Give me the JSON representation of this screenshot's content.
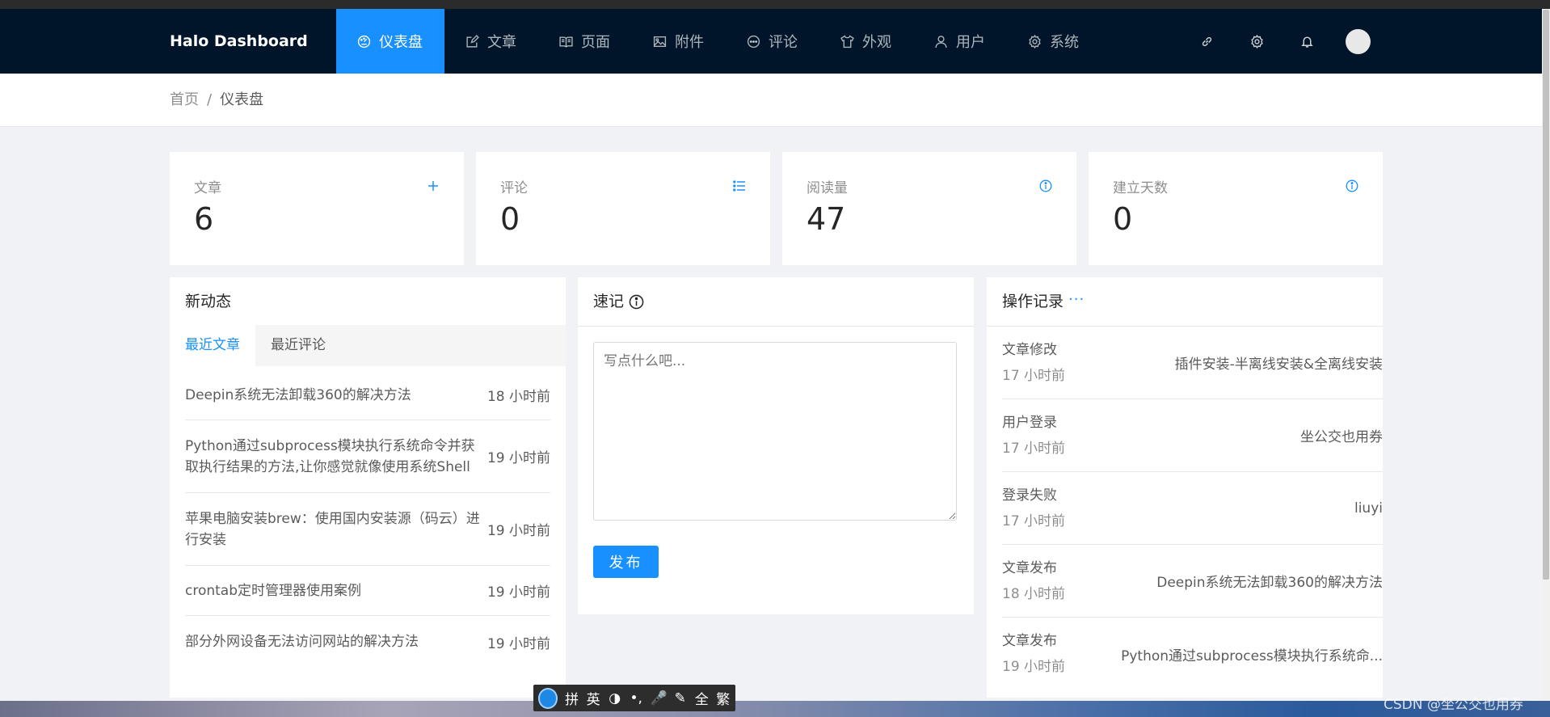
{
  "header": {
    "logo": "Halo  Dashboard",
    "nav": [
      {
        "label": "仪表盘",
        "icon": "dashboard-icon",
        "active": true
      },
      {
        "label": "文章",
        "icon": "edit-icon",
        "active": false
      },
      {
        "label": "页面",
        "icon": "book-icon",
        "active": false
      },
      {
        "label": "附件",
        "icon": "picture-icon",
        "active": false
      },
      {
        "label": "评论",
        "icon": "message-icon",
        "active": false
      },
      {
        "label": "外观",
        "icon": "skin-icon",
        "active": false
      },
      {
        "label": "用户",
        "icon": "user-icon",
        "active": false
      },
      {
        "label": "系统",
        "icon": "setting-icon",
        "active": false
      }
    ],
    "right_icons": [
      "link-icon",
      "gear-icon",
      "bell-icon"
    ]
  },
  "breadcrumb": {
    "home": "首页",
    "sep": "/",
    "current": "仪表盘"
  },
  "stats": [
    {
      "label": "文章",
      "value": "6",
      "icon": "plus-icon"
    },
    {
      "label": "评论",
      "value": "0",
      "icon": "list-icon"
    },
    {
      "label": "阅读量",
      "value": "47",
      "icon": "info-icon"
    },
    {
      "label": "建立天数",
      "value": "0",
      "icon": "info-icon"
    }
  ],
  "activity": {
    "title": "新动态",
    "tabs": [
      "最近文章",
      "最近评论"
    ],
    "posts": [
      {
        "title": "Deepin系统无法卸载360的解决方法",
        "time": "18 小时前"
      },
      {
        "title": "Python通过subprocess模块执行系统命令并获取执行结果的方法,让你感觉就像使用系统Shell",
        "time": "19 小时前"
      },
      {
        "title": "苹果电脑安装brew：使用国内安装源（码云）进行安装",
        "time": "19 小时前"
      },
      {
        "title": "crontab定时管理器使用案例",
        "time": "19 小时前"
      },
      {
        "title": "部分外网设备无法访问网站的解决方法",
        "time": "19 小时前"
      }
    ]
  },
  "memo": {
    "title": "速记",
    "placeholder": "写点什么吧...",
    "publish_label": "发布"
  },
  "logs": {
    "title": "操作记录",
    "items": [
      {
        "action": "文章修改",
        "time": "17 小时前",
        "target": "插件安装-半离线安装&全离线安装"
      },
      {
        "action": "用户登录",
        "time": "17 小时前",
        "target": "坐公交也用券"
      },
      {
        "action": "登录失败",
        "time": "17 小时前",
        "target": "liuyi"
      },
      {
        "action": "文章发布",
        "time": "18 小时前",
        "target": "Deepin系统无法卸载360的解决方法"
      },
      {
        "action": "文章发布",
        "time": "19 小时前",
        "target": "Python通过subprocess模块执行系统命..."
      }
    ]
  },
  "ime": {
    "keys": [
      "拼",
      "英",
      "◑",
      "•,",
      "🎤",
      "✎",
      "全",
      "繁"
    ]
  },
  "watermark": "CSDN @坐公交也用券",
  "colors": {
    "primary": "#1890ff",
    "header_bg": "#001529"
  }
}
